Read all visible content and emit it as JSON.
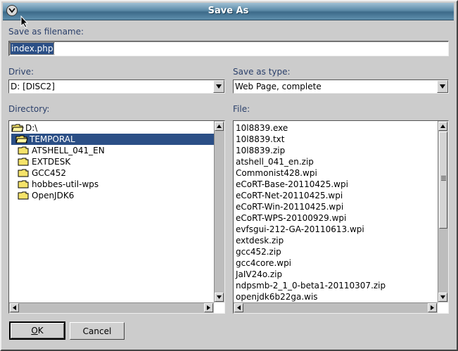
{
  "dialog": {
    "title": "Save As",
    "filename_label": "Save as filename:",
    "filename_value": "index.php",
    "drive_label": "Drive:",
    "drive_value": "D:  [DISC2]",
    "type_label": "Save as type:",
    "type_value": "Web Page, complete",
    "directory_label": "Directory:",
    "file_label": "File:",
    "directories": [
      "D:\\",
      "TEMPORAL",
      "ATSHELL_041_EN",
      "EXTDESK",
      "GCC452",
      "hobbes-util-wps",
      "OpenJDK6"
    ],
    "selected_directory": "TEMPORAL",
    "files": [
      "10l8839.exe",
      "10l8839.txt",
      "10l8839.zip",
      "atshell_041_en.zip",
      "Commonist428.wpi",
      "eCoRT-Base-20110425.wpi",
      "eCoRT-Net-20110425.wpi",
      "eCoRT-Win-20110425.wpi",
      "eCoRT-WPS-20100929.wpi",
      "evfsgui-212-GA-20110613.wpi",
      "extdesk.zip",
      "gcc452.zip",
      "gcc4core.wpi",
      "JaIV24o.zip",
      "ndpsmb-2_1_0-beta1-20110307.zip",
      "openjdk6b22ga.wis"
    ],
    "ok_label_underlined": "O",
    "ok_label_rest": "K",
    "cancel_label": "Cancel"
  },
  "colors": {
    "title_bar": "#5c8ba8",
    "selection": "#2b4f86",
    "dialog_face": "#cccccc",
    "label_text": "#2a3f6a"
  },
  "icons": {
    "system_menu": "chevron-down-icon",
    "folder": "folder-icon",
    "open_folder": "open-folder-icon",
    "dropdown": "triangle-down-icon",
    "cursor": "mouse-pointer-icon"
  }
}
